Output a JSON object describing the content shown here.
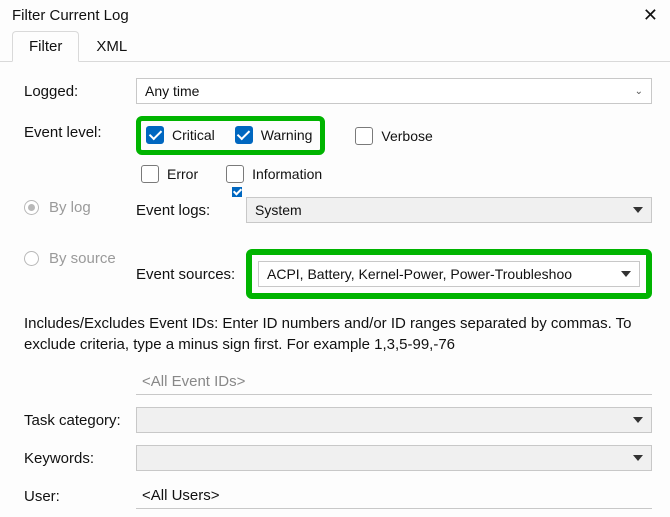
{
  "window": {
    "title": "Filter Current Log"
  },
  "tabs": {
    "filter": "Filter",
    "xml": "XML"
  },
  "labels": {
    "logged": "Logged:",
    "event_level": "Event level:",
    "by_log": "By log",
    "by_source": "By source",
    "event_logs": "Event logs:",
    "event_sources": "Event sources:",
    "task_category": "Task category:",
    "keywords": "Keywords:",
    "user": "User:"
  },
  "logged_value": "Any time",
  "levels": {
    "critical": "Critical",
    "warning": "Warning",
    "verbose": "Verbose",
    "error": "Error",
    "information": "Information"
  },
  "event_logs_value": "System",
  "event_sources_value": "ACPI, Battery, Kernel-Power, Power-Troubleshoo",
  "includes_text": "Includes/Excludes Event IDs: Enter ID numbers and/or ID ranges separated by commas. To exclude criteria, type a minus sign first. For example 1,3,5-99,-76",
  "event_ids_placeholder": "<All Event IDs>",
  "user_placeholder": "<All Users>",
  "highlight_color": "#00b400",
  "accent_color": "#0067c0",
  "checked": {
    "critical": true,
    "warning": true,
    "verbose": false,
    "error": false,
    "information": false
  }
}
